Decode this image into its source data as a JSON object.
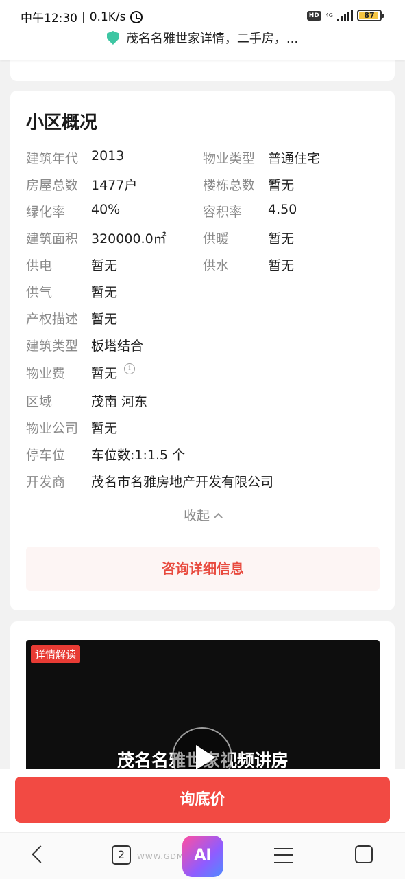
{
  "status_bar": {
    "time": "中午12:30",
    "speed": "0.1K/s",
    "hd": "HD",
    "network": "4G",
    "battery": "87",
    "battery_level": 0.87
  },
  "browser": {
    "url_title": "茂名名雅世家详情，二手房，..."
  },
  "overview": {
    "title": "小区概况",
    "rows": [
      {
        "l1": "建筑年代",
        "v1": "2013",
        "l2": "物业类型",
        "v2": "普通住宅"
      },
      {
        "l1": "房屋总数",
        "v1": "1477户",
        "l2": "楼栋总数",
        "v2": "暂无"
      },
      {
        "l1": "绿化率",
        "v1": "40%",
        "l2": "容积率",
        "v2": "4.50"
      },
      {
        "l1": "建筑面积",
        "v1": "320000.0㎡",
        "l2": "供暖",
        "v2": "暂无"
      },
      {
        "l1": "供电",
        "v1": "暂无",
        "l2": "供水",
        "v2": "暂无"
      },
      {
        "l1": "供气",
        "v1": "暂无"
      },
      {
        "l1": "产权描述",
        "v1": "暂无"
      },
      {
        "l1": "建筑类型",
        "v1": "板塔结合"
      },
      {
        "l1": "物业费",
        "v1": "暂无"
      },
      {
        "l1": "区域",
        "v1": "茂南 河东"
      },
      {
        "l1": "物业公司",
        "v1": "暂无"
      },
      {
        "l1": "停车位",
        "v1": "车位数:1:1.5 个"
      },
      {
        "l1": "开发商",
        "v1": "茂名市名雅房地产开发有限公司"
      }
    ],
    "collapse_label": "收起",
    "consult_label": "咨询详细信息"
  },
  "video": {
    "tag": "详情解读",
    "title": "茂名名雅世家视频讲房"
  },
  "bottom": {
    "price_button": "询底价"
  },
  "navbar": {
    "tab_count": "2",
    "ai_label": "AI",
    "watermark": "WWW.GDMM.COM"
  }
}
